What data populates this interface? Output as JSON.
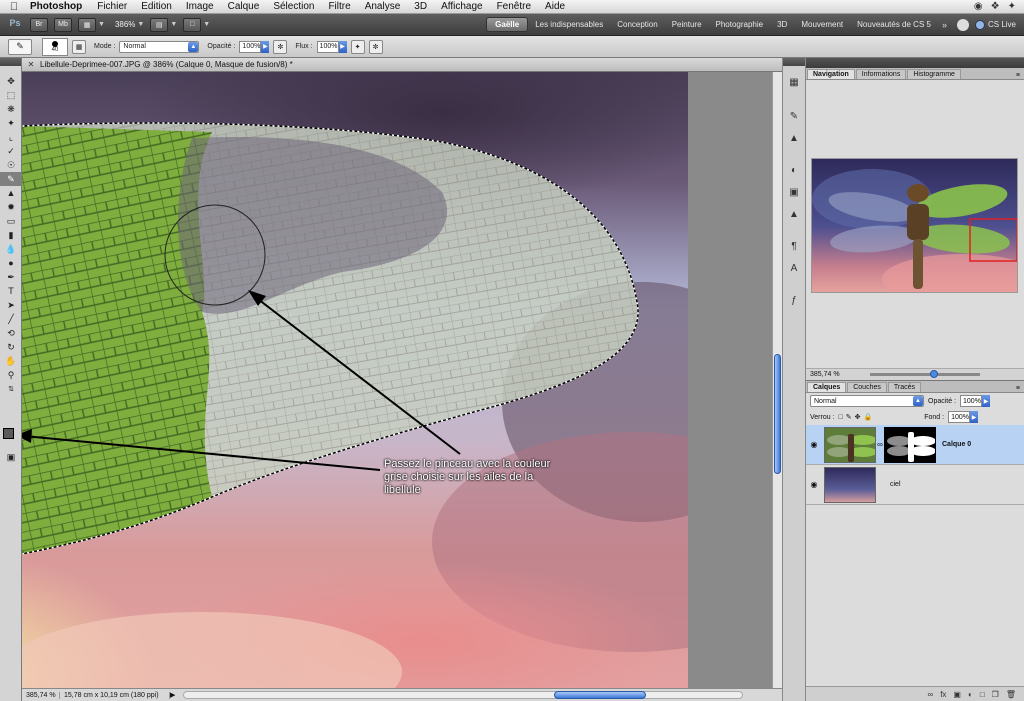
{
  "menubar": {
    "app": "Photoshop",
    "items": [
      "Fichier",
      "Edition",
      "Image",
      "Calque",
      "Sélection",
      "Filtre",
      "Analyse",
      "3D",
      "Affichage",
      "Fenêtre",
      "Aide"
    ]
  },
  "appbar": {
    "logo": "Ps",
    "bridge_label": "Br",
    "minibridge_label": "Mb",
    "zoom": "386%",
    "workspaces": [
      "Gaëlle",
      "Les indispensables",
      "Conception",
      "Peinture",
      "Photographie",
      "3D",
      "Mouvement",
      "Nouveautés de CS 5"
    ],
    "more": "»",
    "cslive": "CS Live"
  },
  "options": {
    "brush_size": "40",
    "mode_label": "Mode :",
    "mode_value": "Normal",
    "opacity_label": "Opacité :",
    "opacity_value": "100%",
    "flow_label": "Flux :",
    "flow_value": "100%"
  },
  "document": {
    "title": "Libellule-Deprimee-007.JPG @ 386% (Calque 0, Masque de fusion/8) *",
    "status_zoom": "385,74 %",
    "status_info": "15,78 cm x 10,19 cm (180 ppi)",
    "annotation": "Passez le pinceau avec la couleur\ngrise choisie sur les ailes de la\nlibellule"
  },
  "nav_panel": {
    "tabs": [
      "Navigation",
      "Informations",
      "Histogramme"
    ],
    "zoom": "385,74 %"
  },
  "layers_panel": {
    "tabs": [
      "Calques",
      "Couches",
      "Tracés"
    ],
    "blend_mode": "Normal",
    "opacity_label": "Opacité :",
    "opacity_value": "100%",
    "lock_label": "Verrou :",
    "fill_label": "Fond :",
    "fill_value": "100%",
    "layers": [
      {
        "name": "Calque 0",
        "selected": true
      },
      {
        "name": "ciel",
        "selected": false
      }
    ]
  },
  "colors": {
    "accent": "#3d79d8",
    "selection_highlight": "#b8d2f3",
    "foreground_color": "#5a5a5a"
  }
}
